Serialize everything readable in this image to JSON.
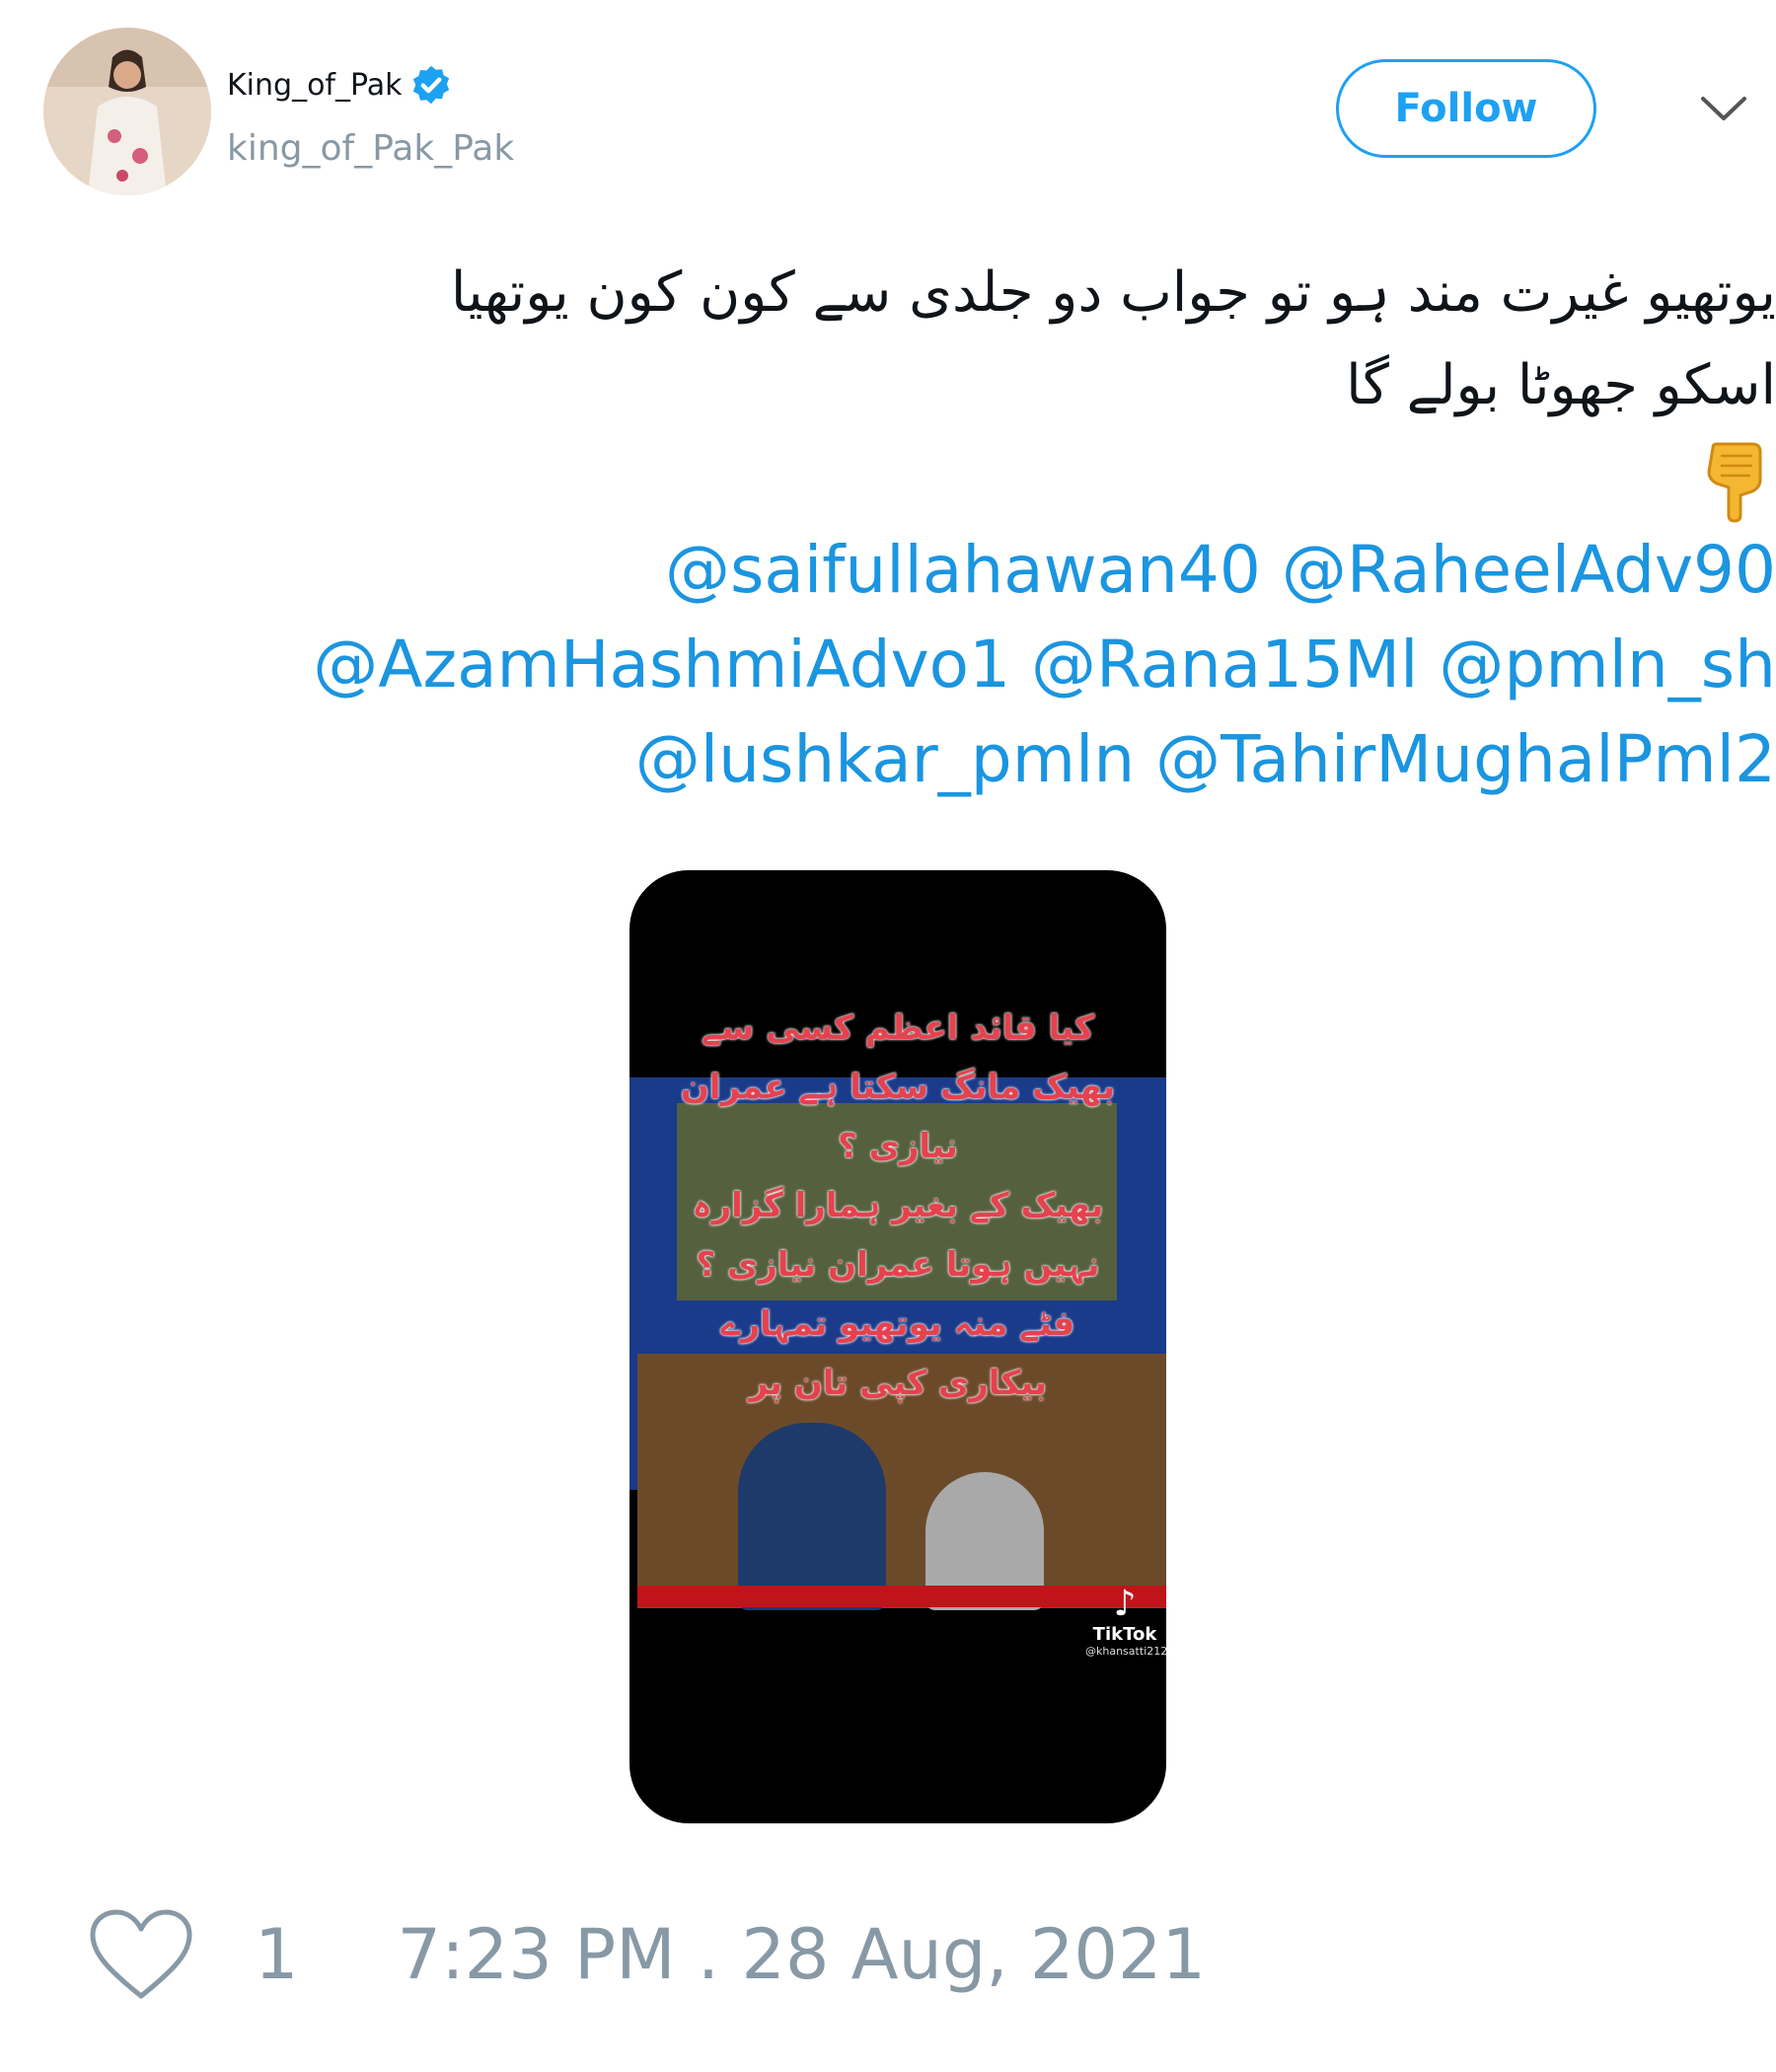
{
  "user": {
    "display_name": "King_of_Pak",
    "handle": "king_of_Pak_Pak",
    "verified_icon": "verified-badge-icon",
    "avatar_icon": "avatar"
  },
  "actions": {
    "follow_label": "Follow",
    "more_icon": "chevron-down-icon"
  },
  "tweet": {
    "line1": "یوتھیو غیرت مند ہو تو جواب دو جلدی سے کون کون یوتھیا",
    "line2": "اسکو جھوٹا بولے گا",
    "emoji": "👇",
    "mentions": [
      [
        "@saifullahawan40",
        "@RaheelAdv90"
      ],
      [
        "@AzamHashmiAdvo1",
        "@Rana15Ml",
        "@pmln_sh"
      ],
      [
        "@lushkar_pmln",
        "@TahirMughalPml2"
      ]
    ]
  },
  "media": {
    "overlay_lines": [
      "کیا قائد اعظم کسی سے",
      "بھیک مانگ سکتا ہے عمران",
      "نیازی ؟",
      "بھیک کے بغیر ہمارا گزارہ",
      "نہیں ہوتا عمران نیازی ؟",
      "فٹے منہ یوتھیو تمہارے",
      "بیکاری کپی تان پر"
    ],
    "tiktok_label": "TikTok",
    "tiktok_user": "@khansatti212"
  },
  "footer": {
    "like_count": "1",
    "timestamp": "7:23 PM . 28 Aug, 2021"
  },
  "colors": {
    "link": "#1b95e0",
    "follow": "#1da1f2",
    "muted": "#8899a6",
    "overlay_text": "#e5424e"
  }
}
